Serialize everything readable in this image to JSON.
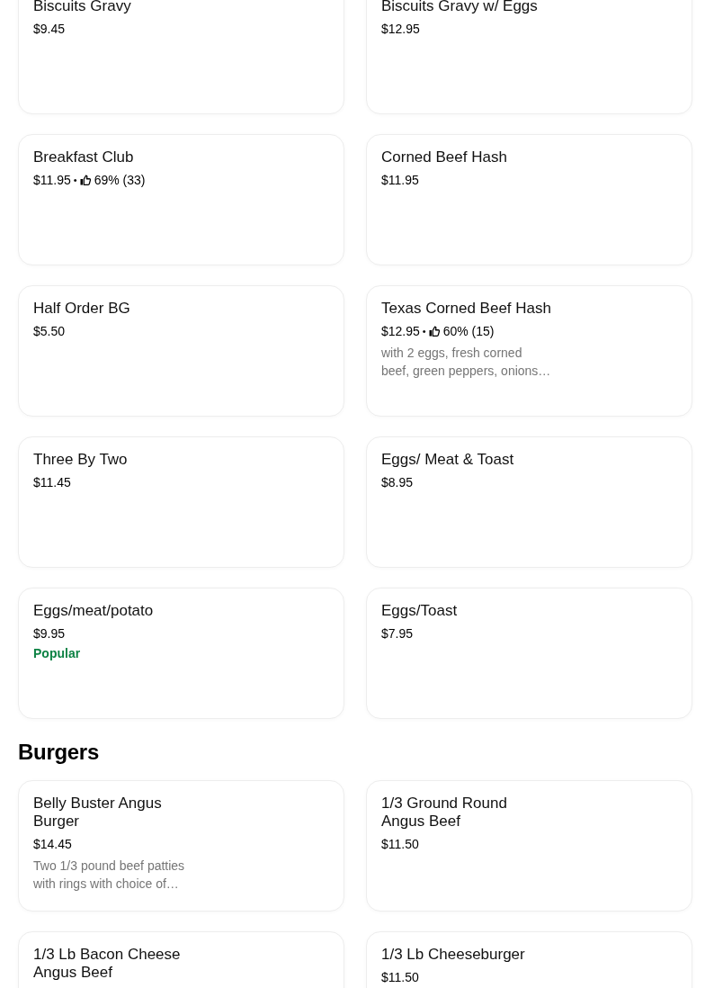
{
  "menu_sections": [
    {
      "items": [
        {
          "name": "Biscuits Gravy",
          "price": "$9.45"
        },
        {
          "name": "Biscuits Gravy w/ Eggs",
          "price": "$12.95"
        },
        {
          "name": "Breakfast Club",
          "price": "$11.95",
          "rating": {
            "separator": "•",
            "score": "69% (33)"
          }
        },
        {
          "name": "Corned Beef Hash",
          "price": "$11.95"
        },
        {
          "name": "Half Order BG",
          "price": "$5.50"
        },
        {
          "name": "Texas Corned Beef Hash",
          "price": "$12.95",
          "rating": {
            "separator": "•",
            "score": "60% (15)"
          },
          "description": "with 2 eggs, fresh corned beef, green peppers, onions…"
        },
        {
          "name": "Three By Two",
          "price": "$11.45"
        },
        {
          "name": "Eggs/ Meat & Toast",
          "price": "$8.95"
        },
        {
          "name": "Eggs/meat/potato",
          "price": "$9.95",
          "tag": "Popular"
        },
        {
          "name": "Eggs/Toast",
          "price": "$7.95"
        }
      ]
    },
    {
      "title": "Burgers",
      "items": [
        {
          "name": "Belly Buster Angus Burger",
          "price": "$14.45",
          "description": "Two 1/3 pound beef patties with rings with choice of…"
        },
        {
          "name": "1/3 Ground Round Angus Beef",
          "price": "$11.50"
        },
        {
          "name": "1/3 Lb Bacon Cheese Angus Beef"
        },
        {
          "name": "1/3 Lb Cheeseburger",
          "price": "$11.50"
        }
      ]
    }
  ]
}
